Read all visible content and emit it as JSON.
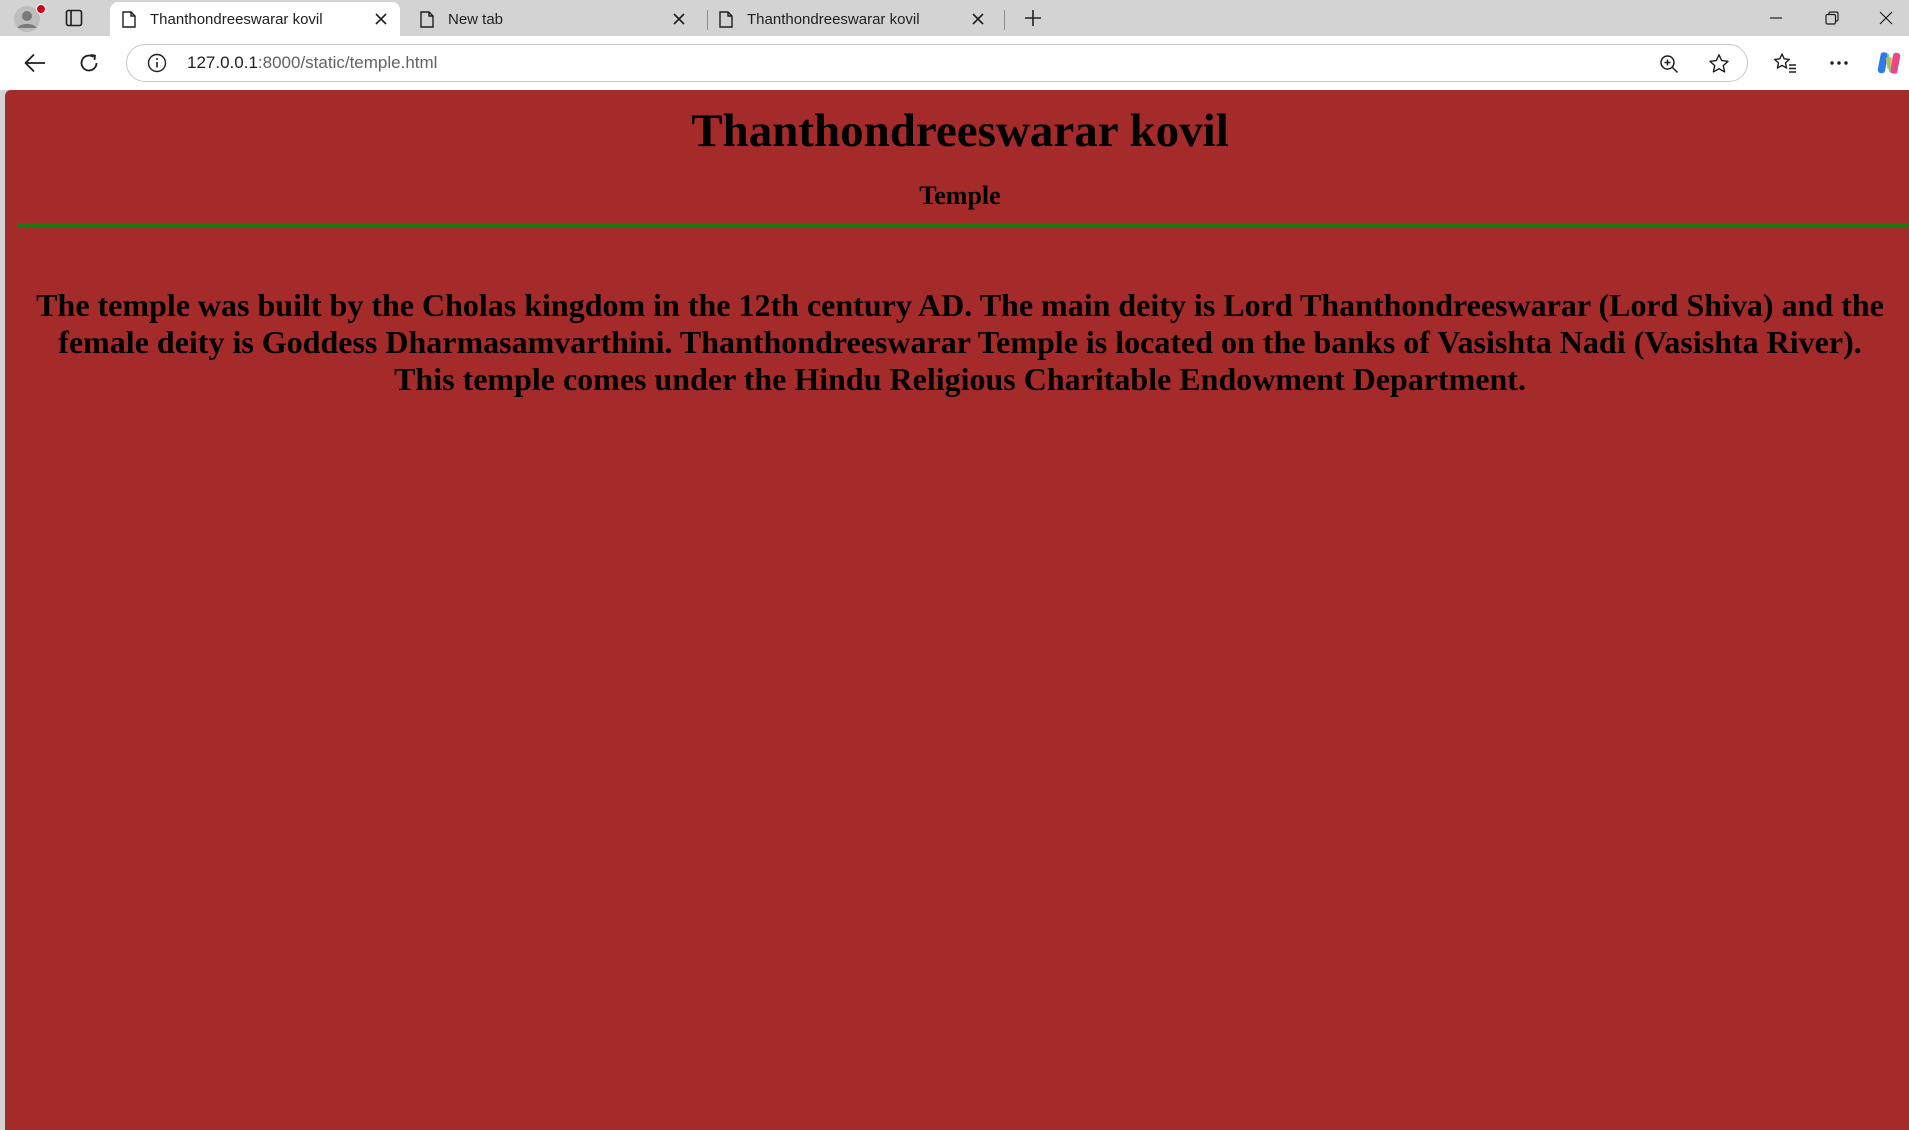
{
  "browser": {
    "tabs": [
      {
        "title": "Thanthondreeswarar kovil",
        "active": true
      },
      {
        "title": "New tab",
        "active": false
      },
      {
        "title": "Thanthondreeswarar kovil",
        "active": false
      }
    ],
    "address_bar": {
      "host": "127.0.0.1",
      "path": ":8000/static/temple.html"
    },
    "icons": {
      "profile": "profile-icon",
      "tab_actions": "tab-actions-icon",
      "favicon": "page-icon",
      "close": "close-icon",
      "new_tab": "plus-icon",
      "back": "back-arrow-icon",
      "reload": "reload-icon",
      "info": "info-icon",
      "zoom": "zoom-in-icon",
      "favorite": "star-icon",
      "favorites": "favorites-icon",
      "menu": "more-icon",
      "copilot": "copilot-icon",
      "minimize": "minimize-icon",
      "restore": "restore-icon",
      "window_close": "close-icon"
    }
  },
  "page": {
    "heading": "Thanthondreeswarar kovil",
    "subheading": "Temple",
    "paragraph": "The temple was built by the Cholas kingdom in the 12th century AD. The main deity is Lord Thanthondreeswarar (Lord Shiva) and the female deity is Goddess Dharmasamvarthini. Thanthondreeswarar Temple is located on the banks of Vasishta Nadi (Vasishta River). This temple comes under the Hindu Religious Charitable Endowment Department.",
    "colors": {
      "background": "#a52a2a",
      "rule": "#1c7a12",
      "text": "#000000"
    }
  }
}
